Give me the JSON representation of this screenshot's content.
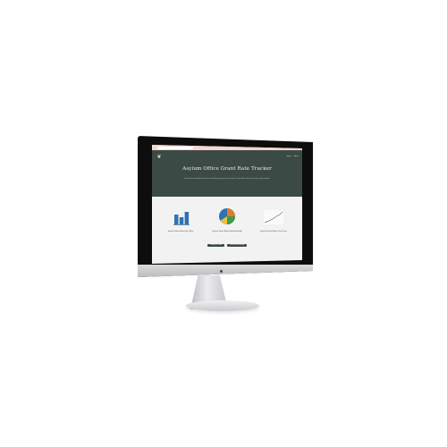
{
  "colors": {
    "hero_bg": "#3b4a45",
    "browser_bar": "#f6d6d0",
    "accent_blue": "#2f72b4",
    "bezel": "#0d0d0d"
  },
  "browser": {
    "url": ""
  },
  "header": {
    "logo_icon": "leaf-monogram-icon",
    "nav": [
      "Home",
      "About"
    ],
    "title": "Asylum Office Grant Rate Tracker",
    "description": "An interactive data dashboard that tracks and visualizes asylum grant rates across U.S. asylum offices, with trends over time and by nationality."
  },
  "cards": [
    {
      "icon": "bar-chart-icon",
      "label": "Search Grant Rates By Office"
    },
    {
      "icon": "pie-chart-icon",
      "label": "Search Grant Rates By Nationality"
    },
    {
      "icon": "line-chart-icon",
      "label": "Search Grant Rates Over Time"
    }
  ],
  "buttons": {
    "primary": "Download the data",
    "secondary": "Read the methodology"
  }
}
